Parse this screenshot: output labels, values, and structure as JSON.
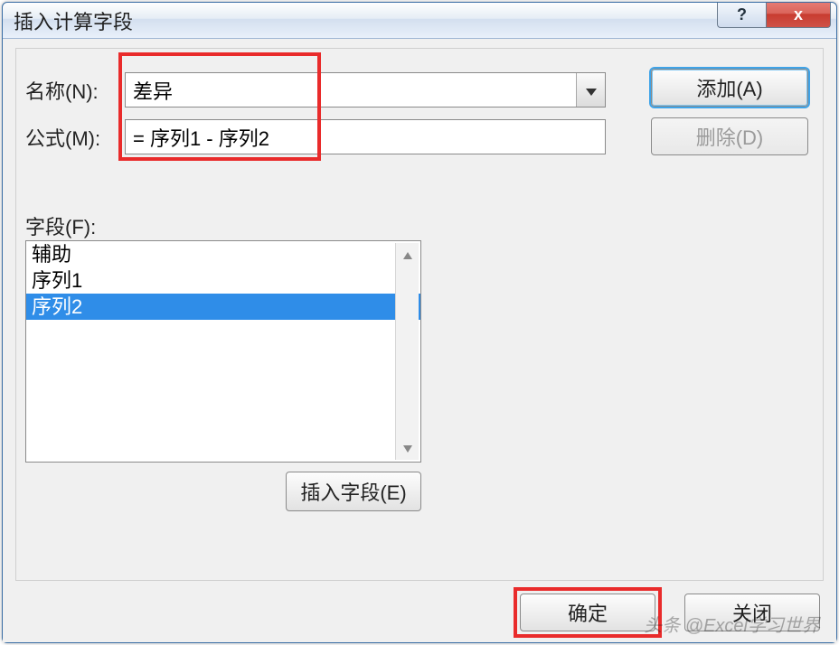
{
  "dialog": {
    "title": "插入计算字段"
  },
  "labels": {
    "name": "名称(N):",
    "formula": "公式(M):",
    "fields": "字段(F):"
  },
  "inputs": {
    "name_value": "差异",
    "formula_value": "= 序列1 - 序列2"
  },
  "buttons": {
    "add": "添加(A)",
    "delete": "删除(D)",
    "insert_field": "插入字段(E)",
    "ok": "确定",
    "close": "关闭"
  },
  "field_list": {
    "items": [
      "辅助",
      "序列1",
      "序列2"
    ],
    "selected_index": 2
  },
  "title_controls": {
    "help": "?",
    "close": "x"
  },
  "watermark": "头条 @Excel学习世界"
}
